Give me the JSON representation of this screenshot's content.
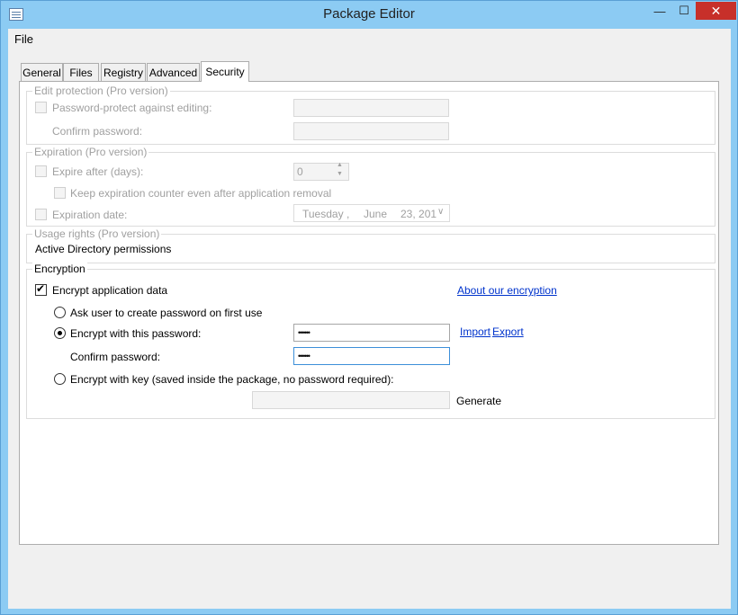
{
  "window": {
    "title": "Package Editor",
    "minimize": "—",
    "maximize": "☐",
    "close": "✕"
  },
  "menu": {
    "file": "File"
  },
  "tabs": [
    {
      "label": "General"
    },
    {
      "label": "Files"
    },
    {
      "label": "Registry"
    },
    {
      "label": "Advanced"
    },
    {
      "label": "Security",
      "active": true
    }
  ],
  "edit_protection": {
    "legend": "Edit protection (Pro version)",
    "protect_label": "Password-protect against editing:",
    "confirm_label": "Confirm password:"
  },
  "expiration": {
    "legend": "Expiration (Pro version)",
    "expire_after_label": "Expire after (days):",
    "days_value": "0",
    "keep_counter_label": "Keep expiration counter even after application removal",
    "date_label": "Expiration date:",
    "date_day": "Tuesday",
    "date_sep": ",",
    "date_month": "June",
    "date_daynum_year": "23, 201"
  },
  "usage_rights": {
    "legend": "Usage rights (Pro version)",
    "ad_label": "Active Directory permissions"
  },
  "encryption": {
    "legend": "Encryption",
    "encrypt_label": "Encrypt application data",
    "about_link": "About our encryption",
    "ask_user_label": "Ask user to create password on first use",
    "with_password_label": "Encrypt with this password:",
    "password_value": "••••••",
    "import_link": "Import",
    "export_link": "Export",
    "confirm_label": "Confirm password:",
    "confirm_value": "••••••",
    "with_key_label": "Encrypt with key (saved inside the package, no password required):",
    "generate_label": "Generate",
    "encrypt_checked": true,
    "selected_mode": "password"
  }
}
